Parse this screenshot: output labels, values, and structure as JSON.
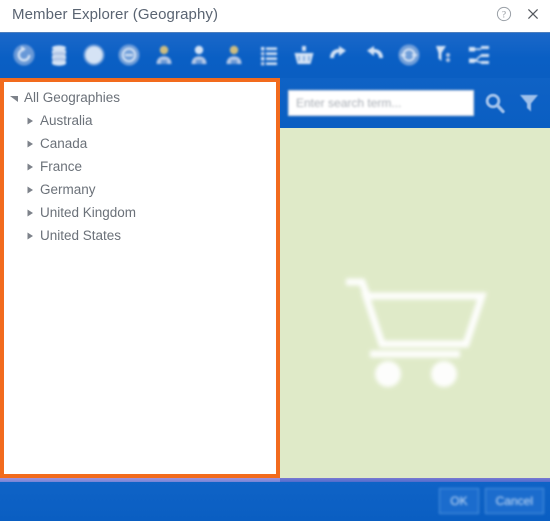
{
  "window": {
    "title": "Member Explorer (Geography)",
    "help_icon": "help-circle-icon",
    "close_icon": "close-icon"
  },
  "toolbar": {
    "items": [
      {
        "name": "refresh-icon",
        "label": "Refresh"
      },
      {
        "name": "database-icon",
        "label": "Database"
      },
      {
        "name": "cancel-circle-icon",
        "label": "Cancel"
      },
      {
        "name": "remove-circle-icon",
        "label": "Remove"
      },
      {
        "name": "member-add-icon",
        "label": "Add Member"
      },
      {
        "name": "member-icon",
        "label": "Member"
      },
      {
        "name": "member-remove-icon",
        "label": "Remove Member"
      },
      {
        "name": "list-properties-icon",
        "label": "Properties"
      },
      {
        "name": "basket-icon",
        "label": "Basket"
      },
      {
        "name": "undo-icon",
        "label": "Undo"
      },
      {
        "name": "redo-icon",
        "label": "Redo"
      },
      {
        "name": "expand-circle-icon",
        "label": "Expand"
      },
      {
        "name": "filter-tag-icon",
        "label": "Filter Tag"
      },
      {
        "name": "hierarchy-icon",
        "label": "Hierarchy"
      }
    ]
  },
  "search": {
    "placeholder": "Enter search term...",
    "value": "",
    "search_icon": "search-icon",
    "filter_icon": "funnel-filter-icon"
  },
  "tree": {
    "items": [
      {
        "label": "All Geographies",
        "level": 0,
        "expanded": true
      },
      {
        "label": "Australia",
        "level": 1,
        "expanded": false
      },
      {
        "label": "Canada",
        "level": 1,
        "expanded": false
      },
      {
        "label": "France",
        "level": 1,
        "expanded": false
      },
      {
        "label": "Germany",
        "level": 1,
        "expanded": false
      },
      {
        "label": "United Kingdom",
        "level": 1,
        "expanded": false
      },
      {
        "label": "United States",
        "level": 1,
        "expanded": false
      }
    ]
  },
  "preview": {
    "watermark_icon": "shopping-cart-icon"
  },
  "footer": {
    "ok_label": "OK",
    "cancel_label": "Cancel"
  },
  "colors": {
    "accent_blue": "#0a5ec2",
    "highlight_orange": "#f26b1d",
    "preview_green": "#dfeac8",
    "title_text": "#5a6472"
  }
}
